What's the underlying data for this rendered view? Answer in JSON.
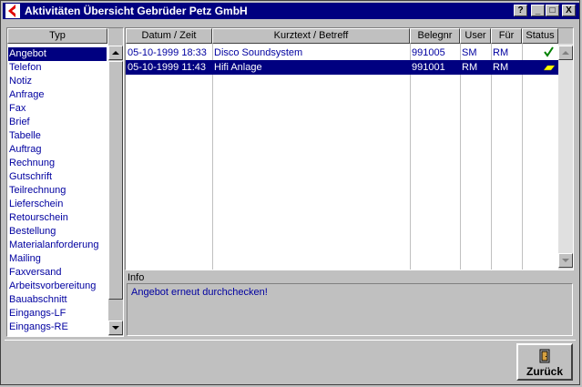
{
  "window": {
    "title": "Aktivitäten Übersicht Gebrüder Petz GmbH"
  },
  "titlebar_buttons": {
    "help": "?",
    "minimize": "_",
    "maximize": "□",
    "close": "X"
  },
  "type_list": {
    "header": "Typ",
    "items": [
      "Angebot",
      "Telefon",
      "Notiz",
      "Anfrage",
      "Fax",
      "Brief",
      "Tabelle",
      "Auftrag",
      "Rechnung",
      "Gutschrift",
      "Teilrechnung",
      "Lieferschein",
      "Retourschein",
      "Bestellung",
      "Materialanforderung",
      "Mailing",
      "Faxversand",
      "Arbeitsvorbereitung",
      "Bauabschnitt",
      "Eingangs-LF",
      "Eingangs-RE"
    ],
    "selected": "Angebot"
  },
  "activities": {
    "columns": [
      "Datum / Zeit",
      "Kurztext / Betreff",
      "Belegnr",
      "User",
      "Für",
      "Status"
    ],
    "rows": [
      {
        "datum": "05-10-1999  18:33",
        "kurztext": "Disco Soundsystem",
        "belegnr": "991005",
        "user": "SM",
        "fuer": "RM",
        "status_icon": "checkmark-icon"
      },
      {
        "datum": "05-10-1999  11:43",
        "kurztext": "Hifi Anlage",
        "belegnr": "991001",
        "user": "RM",
        "fuer": "RM",
        "status_icon": "pencil-icon"
      }
    ],
    "selected_row": 1
  },
  "info": {
    "label": "Info",
    "text": "Angebot erneut durchchecken!"
  },
  "buttons": {
    "back": "Zurück"
  },
  "colors": {
    "selection": "#000080",
    "text_blue": "#0000a0",
    "check_green": "#008000",
    "logo_red": "#e00000"
  }
}
